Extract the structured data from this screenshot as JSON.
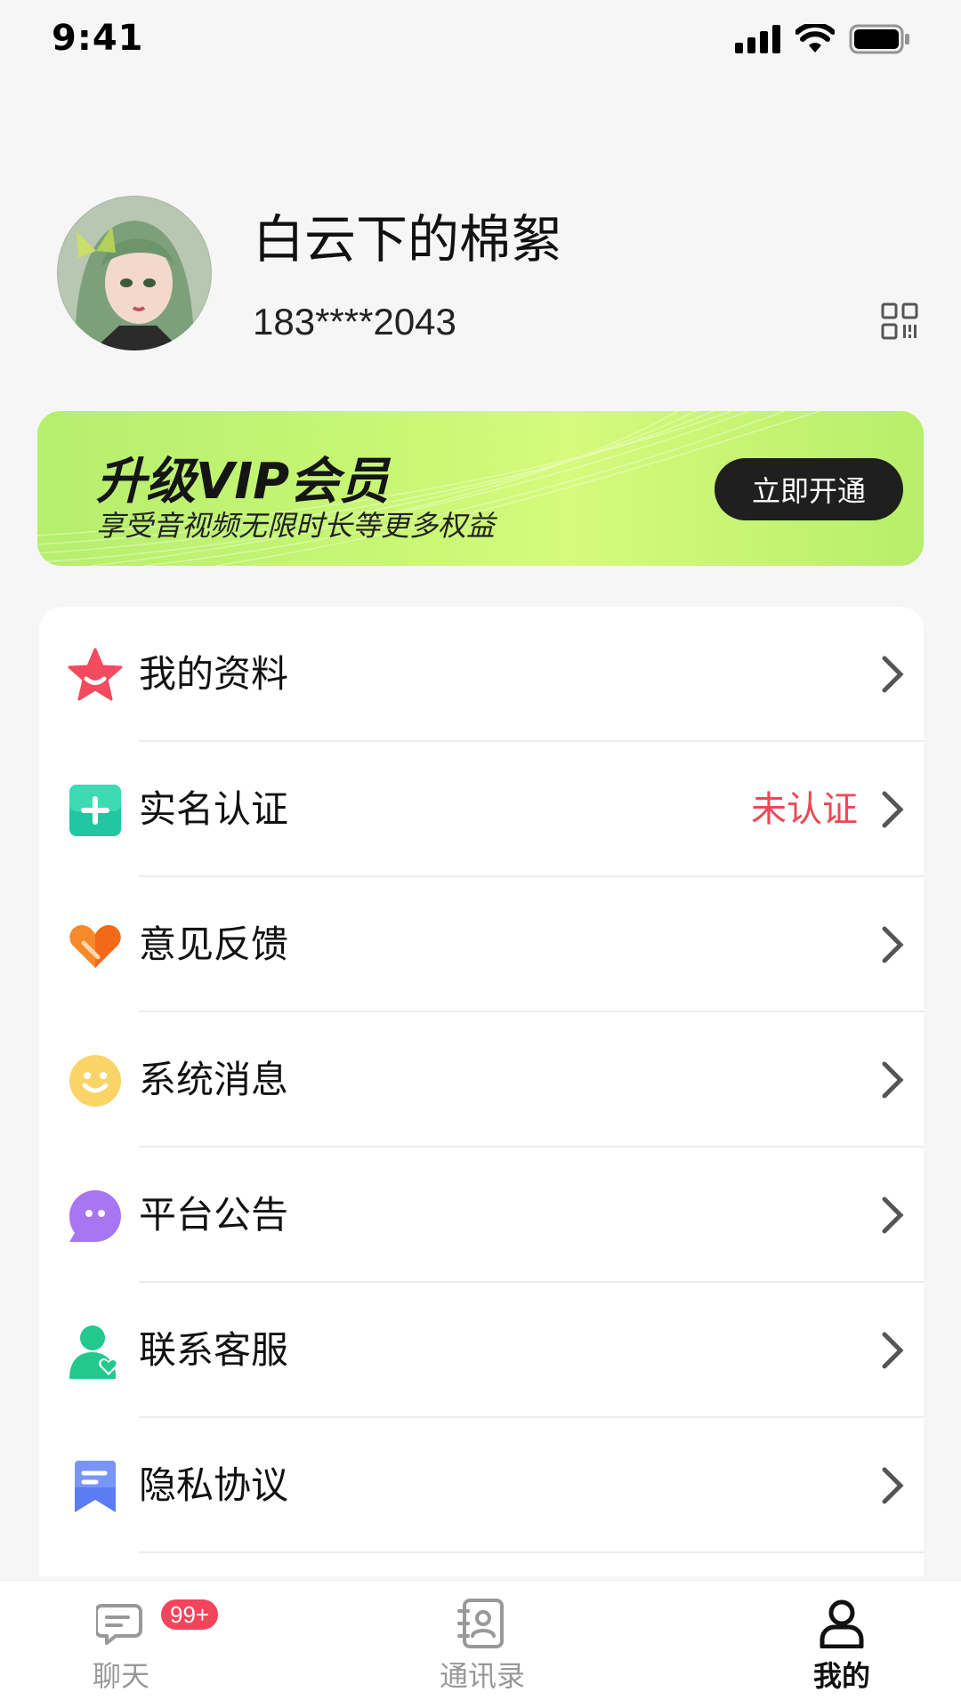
{
  "status_bar": {
    "time": "9:41"
  },
  "profile": {
    "nickname": "白云下的棉絮",
    "phone": "183****2043"
  },
  "vip": {
    "title": "升级VIP会员",
    "subtitle": "享受音视频无限时长等更多权益",
    "button_label": "立即开通"
  },
  "menu": {
    "items": [
      {
        "label": "我的资料",
        "status": "",
        "icon": "star-smile-icon"
      },
      {
        "label": "实名认证",
        "status": "未认证",
        "icon": "plus-square-icon"
      },
      {
        "label": "意见反馈",
        "status": "",
        "icon": "heart-icon"
      },
      {
        "label": "系统消息",
        "status": "",
        "icon": "smiley-icon"
      },
      {
        "label": "平台公告",
        "status": "",
        "icon": "chat-bubble-icon"
      },
      {
        "label": "联系客服",
        "status": "",
        "icon": "user-heart-icon"
      },
      {
        "label": "隐私协议",
        "status": "",
        "icon": "bookmark-icon"
      }
    ]
  },
  "tab_bar": {
    "tabs": [
      {
        "label": "聊天",
        "badge": "99+",
        "icon": "chat-icon"
      },
      {
        "label": "通讯录",
        "icon": "contacts-icon"
      },
      {
        "label": "我的",
        "icon": "profile-icon"
      }
    ],
    "active": "我的"
  },
  "colors": {
    "accent_red": "#ee4756",
    "vip_green": "#c8f774",
    "badge_red": "#f2455b"
  }
}
